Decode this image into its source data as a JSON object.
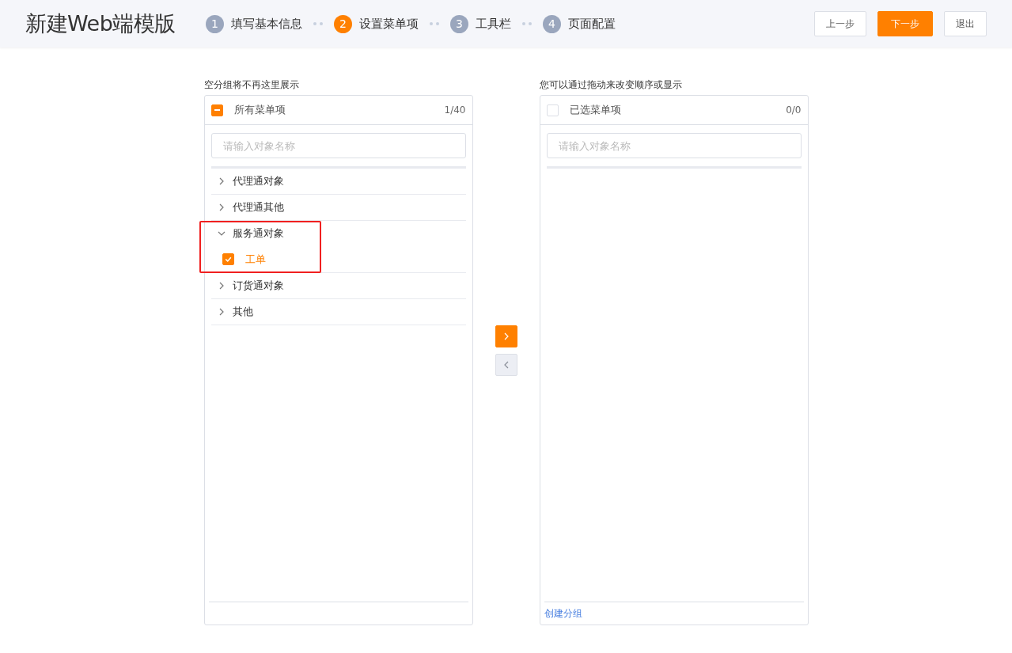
{
  "header": {
    "title": "新建Web端模版",
    "steps": [
      {
        "number": "1",
        "label": "填写基本信息",
        "selected": false
      },
      {
        "number": "2",
        "label": "设置菜单项",
        "selected": true
      },
      {
        "number": "3",
        "label": "工具栏",
        "selected": false
      },
      {
        "number": "4",
        "label": "页面配置",
        "selected": false
      }
    ],
    "buttons": [
      {
        "label": "上一步",
        "kind": "default"
      },
      {
        "label": "下一步",
        "kind": "primary"
      },
      {
        "label": "退出",
        "kind": "default"
      }
    ]
  },
  "source_panel": {
    "hint": "空分组将不再这里展示",
    "title": "所有菜单项",
    "count": "1/40",
    "indeterminate": true,
    "search": {
      "placeholder": "请输入对象名称"
    },
    "groups": [
      {
        "label": "代理通对象",
        "expanded": false,
        "highlighted": false
      },
      {
        "label": "代理通其他",
        "expanded": false,
        "highlighted": false
      },
      {
        "label": "服务通对象",
        "expanded": true,
        "highlighted": true,
        "children": [
          {
            "label": "工单",
            "checked": true
          }
        ]
      },
      {
        "label": "订货通对象",
        "expanded": false,
        "highlighted": false
      },
      {
        "label": "其他",
        "expanded": false,
        "highlighted": false
      }
    ]
  },
  "transfer_buttons": [
    {
      "kind": "right",
      "disabled": false
    },
    {
      "kind": "left",
      "disabled": true
    }
  ],
  "target_panel": {
    "hint": "您可以通过拖动来改变顺序或显示",
    "title": "已选菜单项",
    "count": "0/0",
    "checked": false,
    "search": {
      "placeholder": "请输入对象名称"
    },
    "footer_link": "创建分组"
  }
}
